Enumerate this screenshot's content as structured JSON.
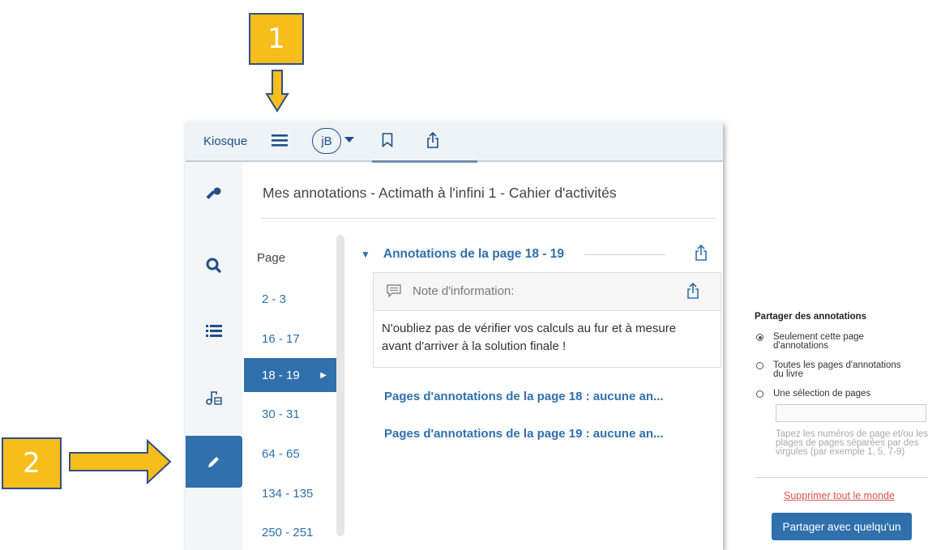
{
  "callouts": {
    "one": "1",
    "two": "2"
  },
  "topbar": {
    "kiosque": "Kiosque",
    "avatar_initials": "jB"
  },
  "panel": {
    "title": "Mes annotations - Actimath à l'infini 1 - Cahier d'activités"
  },
  "pages": {
    "label": "Page",
    "items": [
      "2 - 3",
      "16 - 17",
      "18 - 19",
      "30 - 31",
      "64 - 65",
      "134 - 135",
      "250 - 251"
    ],
    "active_index": 2
  },
  "annotations": {
    "header": "Annotations de la page 18 - 19",
    "note": {
      "label": "Note d'information:",
      "text": "N'oubliez pas de vérifier vos calculs au fur et à mesure avant d'arriver à la solution finale !"
    },
    "sub_links": [
      "Pages d'annotations de la page 18 : aucune an...",
      "Pages d'annotations de la page 19 : aucune an..."
    ]
  },
  "share_panel": {
    "title": "Partager des annotations",
    "options": [
      {
        "label_line1": "Seulement cette page",
        "label_line2": "d'annotations",
        "checked": true
      },
      {
        "label_line1": "Toutes les pages d'annotations",
        "label_line2": "du livre",
        "checked": false
      },
      {
        "label_line1": "Une sélection de pages",
        "label_line2": "",
        "checked": false
      }
    ],
    "page_input_value": "",
    "hint": "Tapez les numéros de page et/ou les plages de pages séparées par des virgules (par exemple 1, 5, 7-9)",
    "delete_all": "Supprimer tout le monde",
    "share_button": "Partager avec quelqu'un"
  },
  "colors": {
    "accent": "#2f70ad",
    "callout": "#f7bd1b",
    "danger": "#d9534f"
  }
}
